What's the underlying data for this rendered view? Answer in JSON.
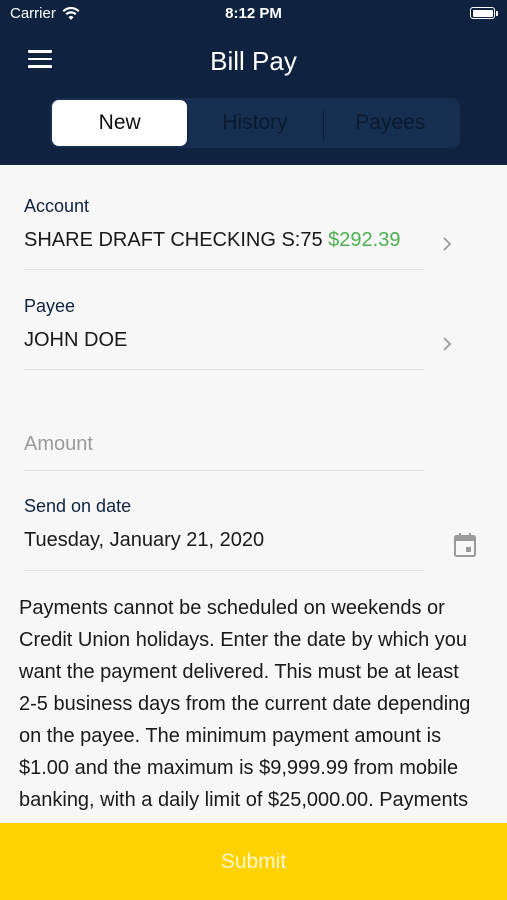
{
  "status_bar": {
    "carrier": "Carrier",
    "time": "8:12 PM"
  },
  "header": {
    "title": "Bill Pay"
  },
  "tabs": [
    {
      "label": "New",
      "selected": true
    },
    {
      "label": "History",
      "selected": false
    },
    {
      "label": "Payees",
      "selected": false
    }
  ],
  "form": {
    "account": {
      "label": "Account",
      "name": "SHARE DRAFT CHECKING S:75",
      "balance": "$292.39"
    },
    "payee": {
      "label": "Payee",
      "value": "JOHN DOE"
    },
    "amount": {
      "placeholder": "Amount"
    },
    "send_date": {
      "label": "Send on date",
      "value": "Tuesday, January 21, 2020"
    }
  },
  "info_text": "Payments cannot be scheduled on weekends or Credit Union holidays. Enter the date by which you want the payment delivered. This must be at least 2-5 business days from the current date depending on the payee. The minimum payment amount is $1.00 and the maximum is $9,999.99 from mobile banking, with a daily limit of $25,000.00. Payments",
  "submit_label": "Submit",
  "colors": {
    "header": "#0f2340",
    "accent_balance": "#4caf50",
    "submit": "#ffd200"
  },
  "icons": [
    "wifi-icon",
    "battery-icon",
    "menu-icon",
    "chevron-right-icon",
    "calendar-icon"
  ]
}
